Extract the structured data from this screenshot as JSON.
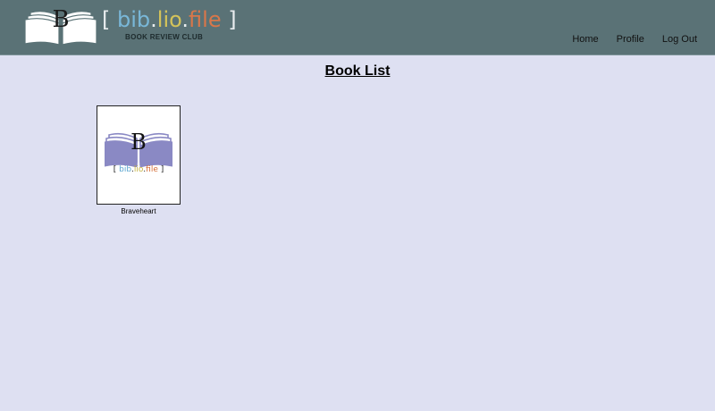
{
  "header": {
    "logo": {
      "bracket_open": "[",
      "word_parts": [
        "bib",
        "lio",
        "file"
      ],
      "dot": ".",
      "bracket_close": "]",
      "tagline": "BOOK REVIEW CLUB",
      "letter": "B",
      "colors": {
        "bib": "#79b7d8",
        "lio": "#d4c35a",
        "file": "#d9774a"
      }
    },
    "nav": {
      "home": "Home",
      "profile": "Profile",
      "logout": "Log Out"
    },
    "background": "#5a7276"
  },
  "main": {
    "title": "Book List",
    "books": [
      {
        "title": "Braveheart",
        "cover": {
          "letter": "B",
          "bracket_open": "[",
          "word_parts": [
            "bib",
            "lio",
            "file"
          ],
          "dot": ".",
          "bracket_close": "]",
          "book_color": "#8a89c4"
        }
      }
    ]
  },
  "page_background": "#dee0f2"
}
